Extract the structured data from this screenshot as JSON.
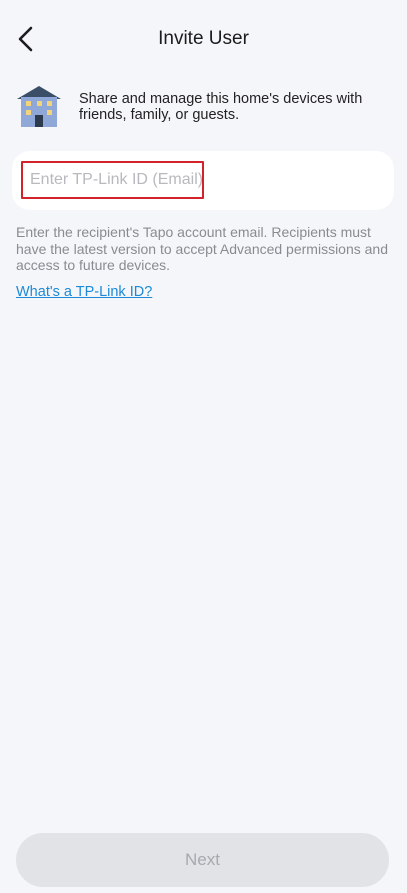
{
  "header": {
    "title": "Invite User",
    "back_icon": "chevron-left-icon"
  },
  "intro": {
    "icon": "house-icon",
    "text": "Share and manage this home's devices with friends, family, or guests."
  },
  "email_field": {
    "value": "",
    "placeholder": "Enter TP-Link ID (Email)",
    "highlight_color": "#d2232a"
  },
  "hint": "Enter the recipient's Tapo account email. Recipients must have the latest version to accept Advanced permissions and access to future devices.",
  "link": "What's a TP-Link ID?",
  "footer": {
    "next_label": "Next",
    "next_enabled": false
  },
  "colors": {
    "background": "#f5f6fa",
    "link": "#1d8ad6",
    "button_disabled": "#e2e3e7"
  }
}
